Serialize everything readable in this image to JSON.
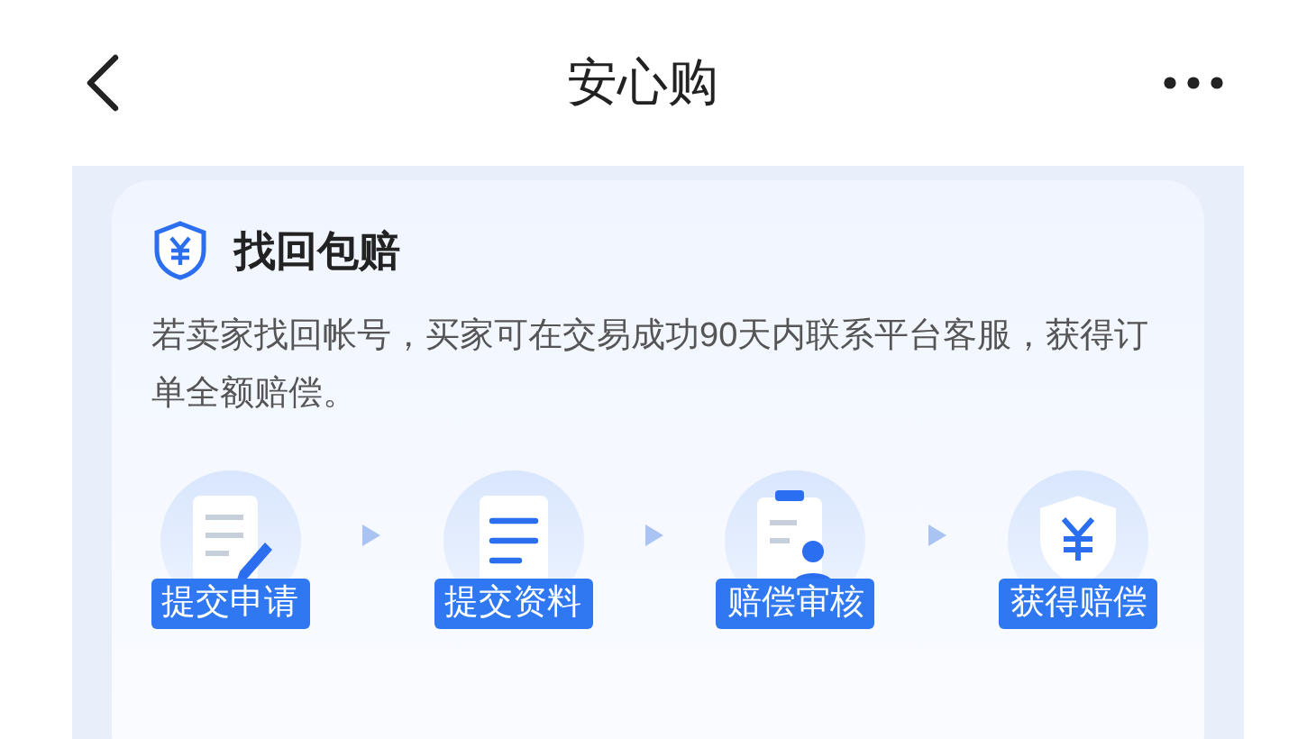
{
  "header": {
    "title": "安心购"
  },
  "card": {
    "title": "找回包赔",
    "description": "若卖家找回帐号，买家可在交易成功90天内联系平台客服，获得订单全额赔偿。"
  },
  "steps": [
    {
      "kind": "apply",
      "label": "提交申请"
    },
    {
      "kind": "documents",
      "label": "提交资料"
    },
    {
      "kind": "review",
      "label": "赔偿审核"
    },
    {
      "kind": "payout",
      "label": "获得赔偿"
    }
  ]
}
